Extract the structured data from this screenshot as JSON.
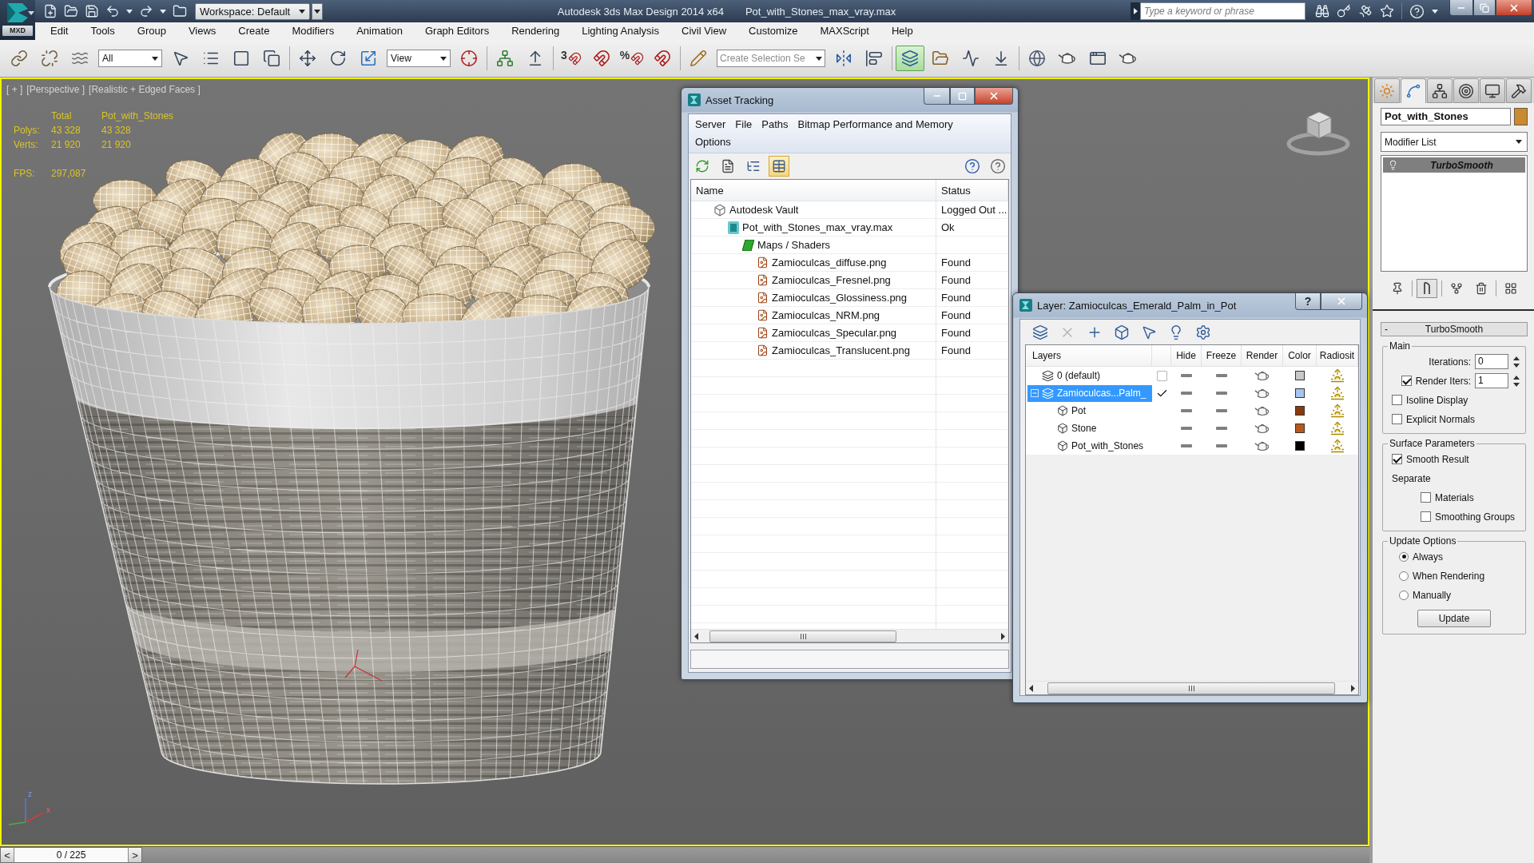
{
  "title_bar": {
    "logo_label": "MXD",
    "workspace": "Workspace: Default",
    "app_name": "Autodesk 3ds Max Design 2014 x64",
    "file_name": "Pot_with_Stones_max_vray.max",
    "search": {
      "placeholder": "Type a keyword or phrase"
    }
  },
  "menu_bar": [
    "Edit",
    "Tools",
    "Group",
    "Views",
    "Create",
    "Modifiers",
    "Animation",
    "Graph Editors",
    "Rendering",
    "Lighting Analysis",
    "Civil View",
    "Customize",
    "MAXScript",
    "Help"
  ],
  "main_toolbar": {
    "groups": [
      [
        {
          "kind": "link",
          "selected": false
        },
        {
          "kind": "unlink",
          "selected": false
        },
        {
          "kind": "bind",
          "selected": false
        },
        {
          "kind": "dropdown",
          "value": "All"
        },
        {
          "kind": "select-object",
          "selected": false
        },
        {
          "kind": "select-by-name",
          "selected": false
        },
        {
          "kind": "region-select",
          "selected": false
        },
        {
          "kind": "window-crossing",
          "selected": false
        }
      ],
      [
        {
          "kind": "move",
          "selected": false
        },
        {
          "kind": "rotate",
          "selected": false
        },
        {
          "kind": "scale",
          "selected": false
        },
        {
          "kind": "dropdown",
          "value": "View"
        },
        {
          "kind": "pivot",
          "selected": false
        }
      ],
      [
        {
          "kind": "manipulate",
          "selected": false
        },
        {
          "kind": "keyboard-override",
          "selected": false
        }
      ],
      [
        {
          "kind": "snap",
          "label": "3",
          "selected": false
        },
        {
          "kind": "angle-snap",
          "selected": false
        },
        {
          "kind": "percent-snap",
          "label": "%",
          "selected": false
        },
        {
          "kind": "spinner-snap",
          "selected": false
        }
      ],
      [
        {
          "kind": "edit-named-selection",
          "selected": false
        },
        {
          "kind": "combo",
          "placeholder": "Create Selection Se"
        },
        {
          "kind": "mirror",
          "selected": false
        },
        {
          "kind": "align",
          "selected": false
        }
      ],
      [
        {
          "kind": "layer-manager",
          "selected": true
        },
        {
          "kind": "scene-explorer",
          "selected": false
        },
        {
          "kind": "curve-editor",
          "selected": false
        },
        {
          "kind": "dope-sheet",
          "selected": false
        }
      ],
      [
        {
          "kind": "material-editor",
          "selected": false
        },
        {
          "kind": "render-setup",
          "selected": false
        },
        {
          "kind": "rendered-frame",
          "selected": false
        },
        {
          "kind": "render",
          "selected": false
        }
      ]
    ]
  },
  "viewport": {
    "active": true,
    "labels": [
      "[ + ]",
      "[Perspective ]",
      "[Realistic + Edged Faces ]"
    ],
    "stats": {
      "columns": [
        "Total",
        "Pot_with_Stones"
      ],
      "rows": [
        {
          "label": "Polys:",
          "values": [
            "43 328",
            "43 328"
          ]
        },
        {
          "label": "Verts:",
          "values": [
            "21 920",
            "21 920"
          ]
        }
      ],
      "fps": {
        "label": "FPS:",
        "value": "297,087"
      }
    },
    "axis_labels": [
      "z",
      "x"
    ]
  },
  "asset_tracking": {
    "title": "Asset Tracking",
    "menu": [
      "Server",
      "File",
      "Paths",
      "Bitmap Performance and Memory",
      "Options"
    ],
    "toolbar": [
      {
        "kind": "refresh",
        "selected": false
      },
      {
        "kind": "list",
        "selected": false
      },
      {
        "kind": "tree",
        "selected": false
      },
      {
        "kind": "table",
        "selected": true
      }
    ],
    "columns": [
      "Name",
      "Status"
    ],
    "tree": [
      {
        "kind": "vault",
        "name": "Autodesk Vault",
        "status": "Logged Out ...",
        "children": [
          {
            "kind": "scene",
            "name": "Pot_with_Stones_max_vray.max",
            "status": "Ok",
            "children": [
              {
                "kind": "folder",
                "name": "Maps / Shaders",
                "children": [
                  {
                    "kind": "bitmap",
                    "name": "Zamioculcas_diffuse.png",
                    "status": "Found"
                  },
                  {
                    "kind": "bitmap",
                    "name": "Zamioculcas_Fresnel.png",
                    "status": "Found"
                  },
                  {
                    "kind": "bitmap",
                    "name": "Zamioculcas_Glossiness.png",
                    "status": "Found"
                  },
                  {
                    "kind": "bitmap",
                    "name": "Zamioculcas_NRM.png",
                    "status": "Found"
                  },
                  {
                    "kind": "bitmap",
                    "name": "Zamioculcas_Specular.png",
                    "status": "Found"
                  },
                  {
                    "kind": "bitmap",
                    "name": "Zamioculcas_Translucent.png",
                    "status": "Found"
                  }
                ]
              }
            ]
          }
        ]
      }
    ]
  },
  "layer_manager": {
    "title": "Layer: Zamioculcas_Emerald_Palm_in_Pot",
    "help_button": "?",
    "toolbar": [
      {
        "kind": "new-layer",
        "disabled": false
      },
      {
        "kind": "delete",
        "disabled": true
      },
      {
        "kind": "add",
        "disabled": false
      },
      {
        "kind": "select-objects",
        "disabled": false
      },
      {
        "kind": "select-layer",
        "disabled": false
      },
      {
        "kind": "highlight",
        "disabled": false
      },
      {
        "kind": "settings",
        "disabled": false
      }
    ],
    "columns": [
      "Layers",
      "Hide",
      "Freeze",
      "Render",
      "Color",
      "Radiosit"
    ],
    "layers": [
      {
        "kind": "layer",
        "name": "0 (default)",
        "current": false,
        "selected": false,
        "hidden": false,
        "frozen": false,
        "color": "#c8c8c8"
      },
      {
        "kind": "layer",
        "name": "Zamioculcas...Palm_",
        "current": true,
        "selected": true,
        "expanded": true,
        "hidden": false,
        "frozen": false,
        "color": "#a6c4ee",
        "children": [
          {
            "kind": "object",
            "name": "Pot",
            "selected": false,
            "hidden": false,
            "frozen": false,
            "color": "#8a3a0c"
          },
          {
            "kind": "object",
            "name": "Stone",
            "selected": false,
            "hidden": false,
            "frozen": false,
            "color": "#b9581c"
          },
          {
            "kind": "object",
            "name": "Pot_with_Stones",
            "selected": false,
            "hidden": false,
            "frozen": false,
            "color": "#000000"
          }
        ]
      }
    ]
  },
  "command_panel": {
    "tabs": [
      {
        "kind": "create",
        "selected": false
      },
      {
        "kind": "modify",
        "selected": true
      },
      {
        "kind": "hierarchy",
        "selected": false
      },
      {
        "kind": "motion",
        "selected": false
      },
      {
        "kind": "display",
        "selected": false
      },
      {
        "kind": "utilities",
        "selected": false
      }
    ],
    "object_name": "Pot_with_Stones",
    "modifier_list": "Modifier List",
    "modifier_stack": [
      {
        "name": "TurboSmooth",
        "selected": true
      }
    ],
    "stack_tools": [
      {
        "kind": "pin",
        "selected": false
      },
      {
        "kind": "show-end-result",
        "selected": true
      },
      {
        "kind": "make-unique",
        "selected": false
      },
      {
        "kind": "remove",
        "selected": false
      },
      {
        "kind": "configure",
        "selected": false
      }
    ],
    "rollout": {
      "collapse": "-",
      "title": "TurboSmooth",
      "groups": [
        {
          "title": "Main",
          "items": [
            {
              "kind": "spinner",
              "label": "Iterations:",
              "value": "0"
            },
            {
              "kind": "check-spinner",
              "label": "Render Iters:",
              "checked": true,
              "value": "1"
            },
            {
              "kind": "checkbox",
              "label": "Isoline Display",
              "checked": false
            },
            {
              "kind": "checkbox",
              "label": "Explicit Normals",
              "checked": false
            }
          ]
        },
        {
          "title": "Surface Parameters",
          "items": [
            {
              "kind": "checkbox",
              "label": "Smooth Result",
              "checked": true
            },
            {
              "kind": "label",
              "label": "Separate"
            },
            {
              "kind": "sub-checkbox",
              "label": "Materials",
              "checked": false
            },
            {
              "kind": "sub-checkbox",
              "label": "Smoothing Groups",
              "checked": false
            }
          ]
        },
        {
          "title": "Update Options",
          "items": [
            {
              "kind": "radio",
              "label": "Always",
              "selected": true
            },
            {
              "kind": "radio",
              "label": "When Rendering",
              "selected": false
            },
            {
              "kind": "radio",
              "label": "Manually",
              "selected": false
            },
            {
              "kind": "button",
              "label": "Update"
            }
          ]
        }
      ]
    }
  },
  "time_slider": {
    "previous": "<",
    "frame": "0 / 225",
    "next": ">",
    "level": 0
  }
}
